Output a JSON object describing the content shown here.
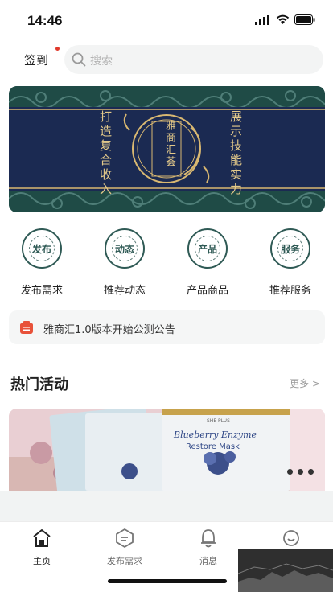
{
  "status_bar": {
    "time": "14:46"
  },
  "header": {
    "checkin_label": "签到",
    "search_placeholder": "搜索"
  },
  "banner": {
    "left_text": "打造复合收入",
    "center_text": "雅商汇荟",
    "right_text": "展示技能实力"
  },
  "quick_menu": [
    {
      "label": "发布需求",
      "icon_text": "发布"
    },
    {
      "label": "推荐动态",
      "icon_text": "动态"
    },
    {
      "label": "产品商品",
      "icon_text": "产品"
    },
    {
      "label": "推荐服务",
      "icon_text": "服务"
    }
  ],
  "notice": {
    "text": "雅商汇1.0版本开始公测公告"
  },
  "hot": {
    "title": "热门活动",
    "more_label": "更多 >",
    "product_brand": "SHE PLUS",
    "product_name_1": "Blueberry Enzyme",
    "product_name_2": "Restore Mask"
  },
  "tabbar": [
    {
      "label": "主页",
      "active": true
    },
    {
      "label": "发布需求",
      "active": false
    },
    {
      "label": "消息",
      "active": false
    },
    {
      "label": "",
      "active": false
    }
  ],
  "colors": {
    "accent": "#1d4a45",
    "gold": "#d9b871",
    "notice": "#e8523a"
  }
}
